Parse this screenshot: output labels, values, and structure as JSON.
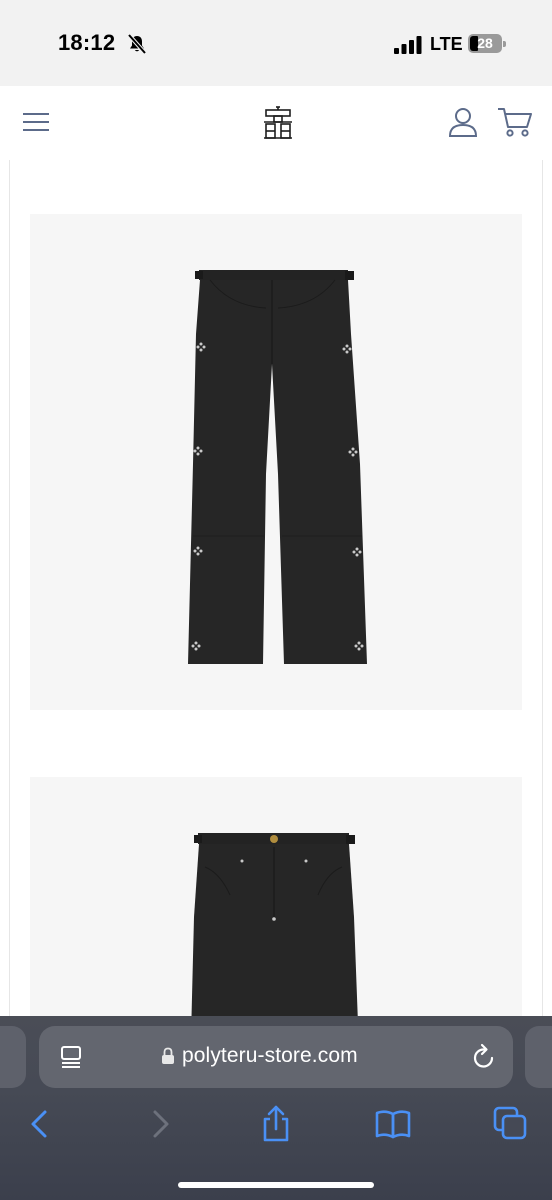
{
  "status_bar": {
    "time": "18:12",
    "network": "LTE",
    "battery": "28",
    "battery_level": 0.28,
    "icons": [
      "bell-slash-icon",
      "signal-icon",
      "battery-icon"
    ]
  },
  "site_header": {
    "icons": [
      "hamburger-menu-icon",
      "brand-logo",
      "user-icon",
      "cart-icon"
    ],
    "accent_color": "#5c6b8a"
  },
  "products": [
    {
      "image": "black pants back view",
      "background": "#f6f6f6"
    },
    {
      "image": "black pants front view",
      "background": "#f6f6f6"
    }
  ],
  "browser": {
    "url": "polyteru-store.com",
    "icons": [
      "reader-icon",
      "lock-icon",
      "reload-icon",
      "back-icon",
      "forward-icon",
      "share-icon",
      "bookmarks-icon",
      "tabs-icon"
    ],
    "accent_color": "#4a90f5"
  }
}
